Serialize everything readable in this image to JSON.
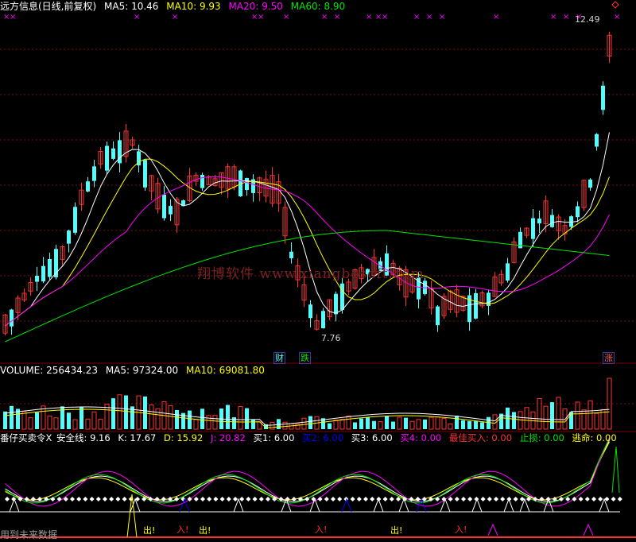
{
  "price_header": {
    "name": "远方信息(日线,前复权)",
    "ma5": "MA5: 10.46",
    "ma10": "MA10: 9.93",
    "ma20": "MA20: 9.50",
    "ma60": "MA60: 8.90"
  },
  "volume_header": {
    "volume": "VOLUME: 256434.23",
    "ma5": "MA5: 97324.00",
    "ma10": "MA10: 69081.80"
  },
  "indicator_header": {
    "name": "番仔买卖令X",
    "safe_line": "安全线: 9.16",
    "k": "K: 17.67",
    "d": "D: 15.92",
    "j": "J: 20.82",
    "buy1": "买1: 6.00",
    "buy2": "买2: 6.00",
    "buy3": "买3: 6.00",
    "buy4": "买4: 0.00",
    "best_buy": "最佳买入: 0.00",
    "stop_loss": "止损: 0.00",
    "escape": "逃命: 0.00"
  },
  "price_labels": {
    "high": "12.49",
    "low": "7.76"
  },
  "event_tags": {
    "cai": "财",
    "die": "跌",
    "zhang": "涨"
  },
  "signal_tags": {
    "chu": "出!",
    "ru": "入!"
  },
  "watermark": "翔博软件 www.xiangbosoft.com",
  "footer_text": "用到未来数据",
  "colors": {
    "up": "#ff3232",
    "down": "#54fcfc",
    "ma5": "#ffffff",
    "ma10": "#ffff00",
    "ma20": "#ff00ff",
    "ma60": "#00e600",
    "dashed": "#8b0000"
  }
}
